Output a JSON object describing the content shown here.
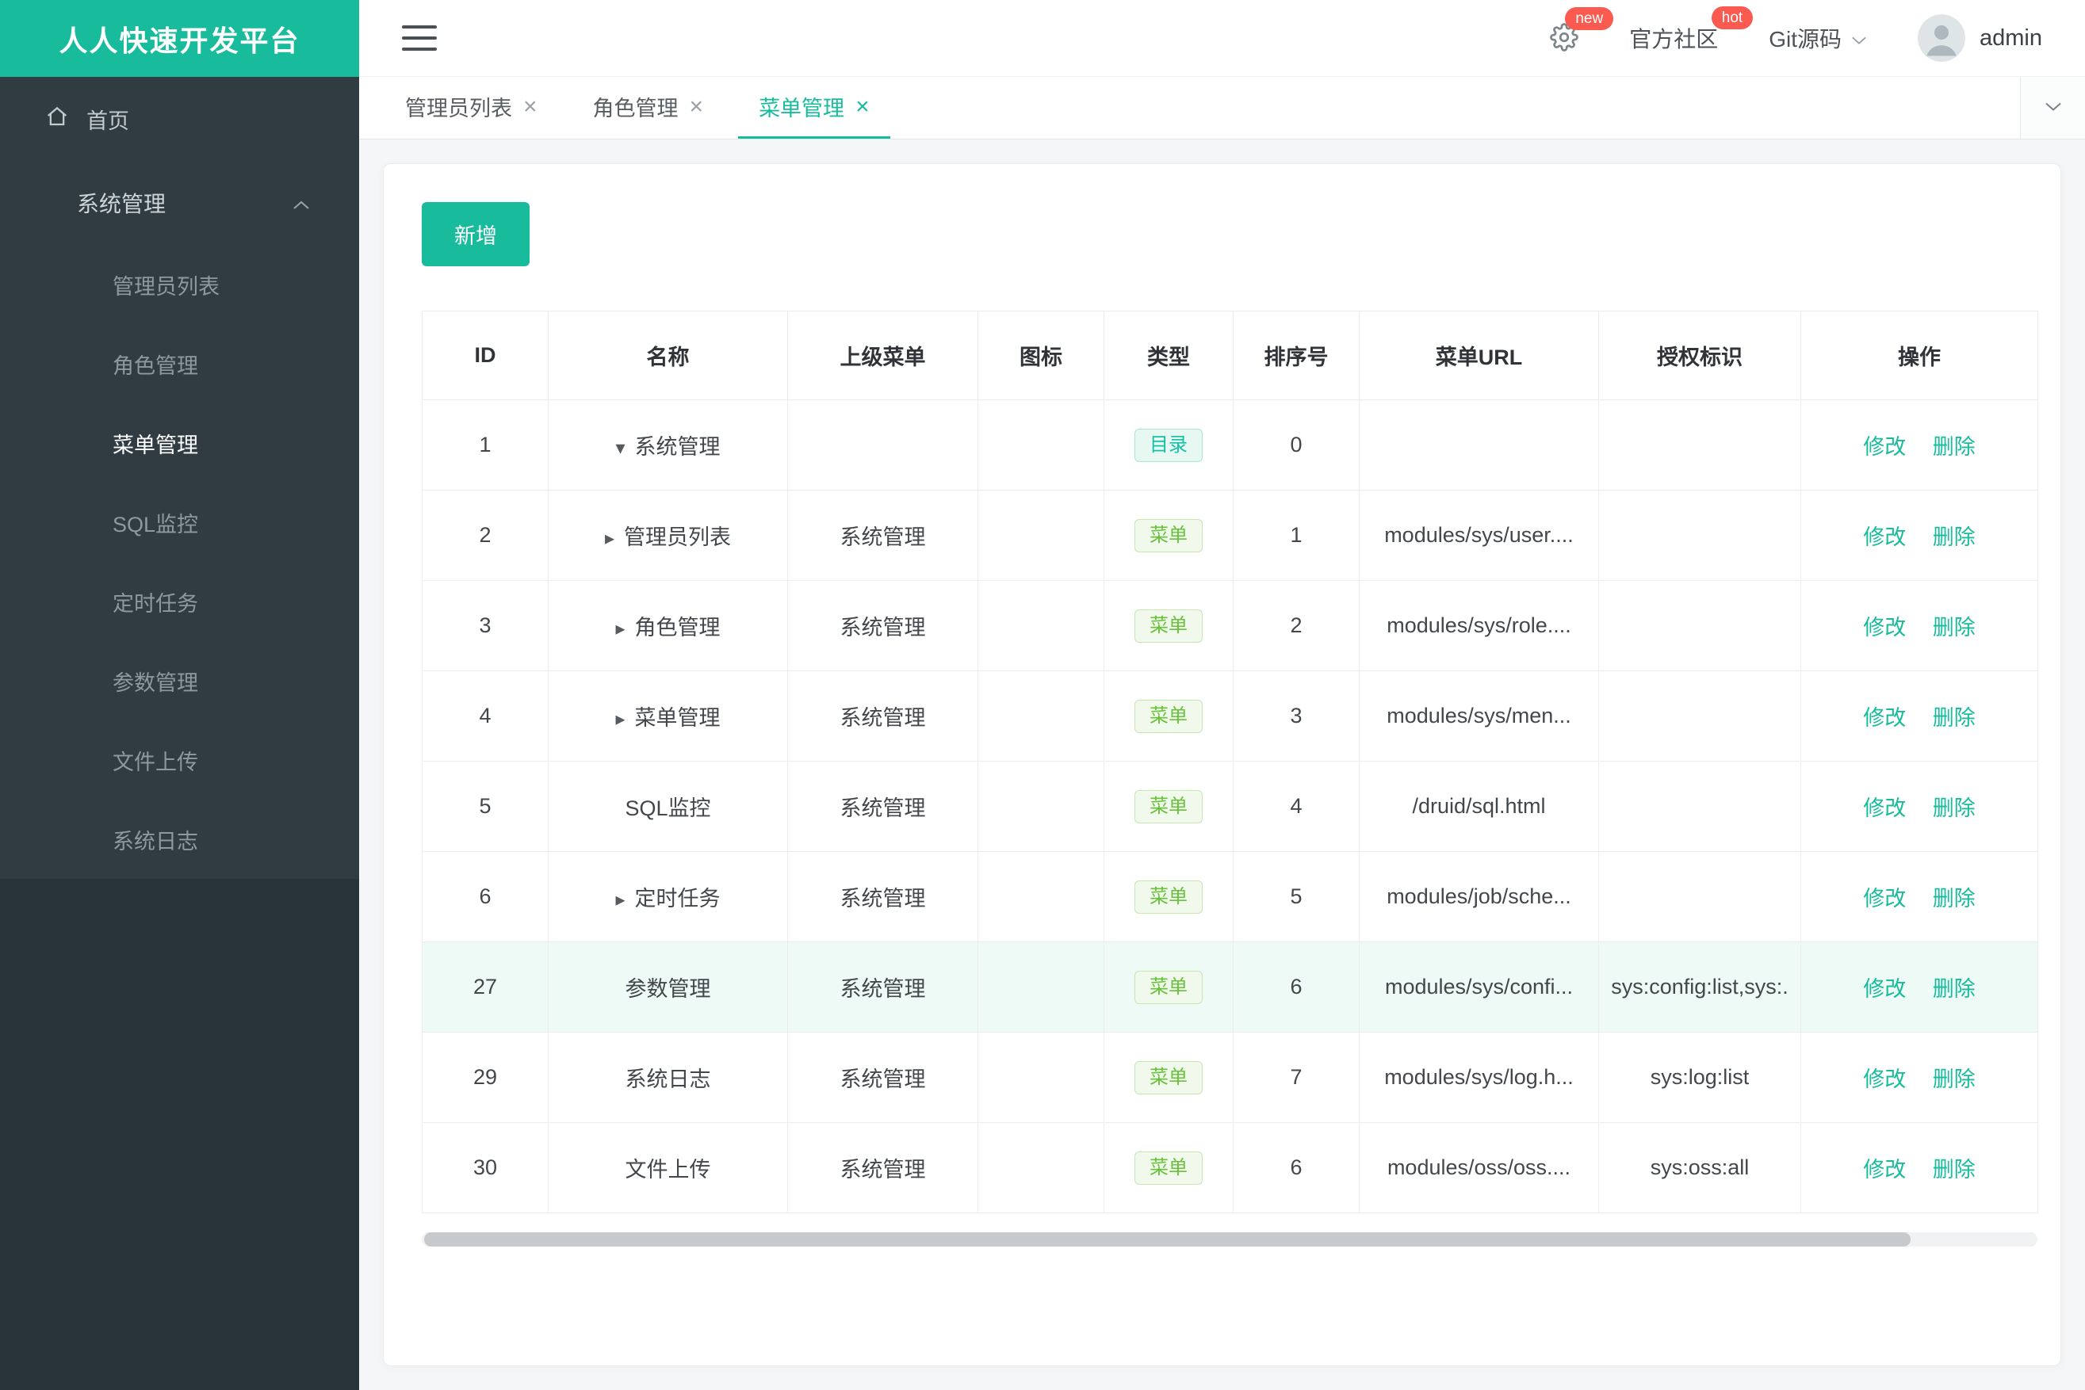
{
  "brand": {
    "title": "人人快速开发平台"
  },
  "header": {
    "settings_badge": "new",
    "community_label": "官方社区",
    "community_badge": "hot",
    "git_label": "Git源码",
    "username": "admin"
  },
  "sidebar": {
    "home_label": "首页",
    "group_label": "系统管理",
    "items": [
      {
        "key": "admin-list",
        "label": "管理员列表",
        "active": false
      },
      {
        "key": "role",
        "label": "角色管理",
        "active": false
      },
      {
        "key": "menu",
        "label": "菜单管理",
        "active": true
      },
      {
        "key": "sql",
        "label": "SQL监控",
        "active": false
      },
      {
        "key": "job",
        "label": "定时任务",
        "active": false
      },
      {
        "key": "config",
        "label": "参数管理",
        "active": false
      },
      {
        "key": "oss",
        "label": "文件上传",
        "active": false
      },
      {
        "key": "log",
        "label": "系统日志",
        "active": false
      }
    ]
  },
  "tabs": [
    {
      "key": "admin-list",
      "label": "管理员列表",
      "active": false
    },
    {
      "key": "role",
      "label": "角色管理",
      "active": false
    },
    {
      "key": "menu",
      "label": "菜单管理",
      "active": true
    }
  ],
  "toolbar": {
    "add_label": "新增"
  },
  "table": {
    "headers": [
      "ID",
      "名称",
      "上级菜单",
      "图标",
      "类型",
      "排序号",
      "菜单URL",
      "授权标识",
      "操作"
    ],
    "actions": {
      "edit": "修改",
      "delete": "删除"
    },
    "type_tags": {
      "dir": "目录",
      "menu": "菜单"
    },
    "rows": [
      {
        "id": "1",
        "caret": "down",
        "name": "系统管理",
        "parent": "",
        "icon": "",
        "type": "dir",
        "order": "0",
        "url": "",
        "perms": "",
        "highlight": false
      },
      {
        "id": "2",
        "caret": "right",
        "name": "管理员列表",
        "parent": "系统管理",
        "icon": "",
        "type": "menu",
        "order": "1",
        "url": "modules/sys/user....",
        "perms": "",
        "highlight": false
      },
      {
        "id": "3",
        "caret": "right",
        "name": "角色管理",
        "parent": "系统管理",
        "icon": "",
        "type": "menu",
        "order": "2",
        "url": "modules/sys/role....",
        "perms": "",
        "highlight": false
      },
      {
        "id": "4",
        "caret": "right",
        "name": "菜单管理",
        "parent": "系统管理",
        "icon": "",
        "type": "menu",
        "order": "3",
        "url": "modules/sys/men...",
        "perms": "",
        "highlight": false
      },
      {
        "id": "5",
        "caret": "",
        "name": "SQL监控",
        "parent": "系统管理",
        "icon": "",
        "type": "menu",
        "order": "4",
        "url": "/druid/sql.html",
        "perms": "",
        "highlight": false
      },
      {
        "id": "6",
        "caret": "right",
        "name": "定时任务",
        "parent": "系统管理",
        "icon": "",
        "type": "menu",
        "order": "5",
        "url": "modules/job/sche...",
        "perms": "",
        "highlight": false
      },
      {
        "id": "27",
        "caret": "",
        "name": "参数管理",
        "parent": "系统管理",
        "icon": "",
        "type": "menu",
        "order": "6",
        "url": "modules/sys/confi...",
        "perms": "sys:config:list,sys:.",
        "highlight": true
      },
      {
        "id": "29",
        "caret": "",
        "name": "系统日志",
        "parent": "系统管理",
        "icon": "",
        "type": "menu",
        "order": "7",
        "url": "modules/sys/log.h...",
        "perms": "sys:log:list",
        "highlight": false
      },
      {
        "id": "30",
        "caret": "",
        "name": "文件上传",
        "parent": "系统管理",
        "icon": "",
        "type": "menu",
        "order": "6",
        "url": "modules/oss/oss....",
        "perms": "sys:oss:all",
        "highlight": false
      }
    ]
  },
  "colors": {
    "accent": "#18bc9c",
    "badge_red": "#fb5a50",
    "tag_dir_text": "#13c2a3",
    "tag_dir_bg": "#e7f8f3",
    "tag_dir_border": "#a9e6d6",
    "tag_menu_text": "#67c23a",
    "tag_menu_bg": "#f0f9eb",
    "tag_menu_border": "#c6e7ad",
    "row_highlight": "#eefaf5"
  }
}
